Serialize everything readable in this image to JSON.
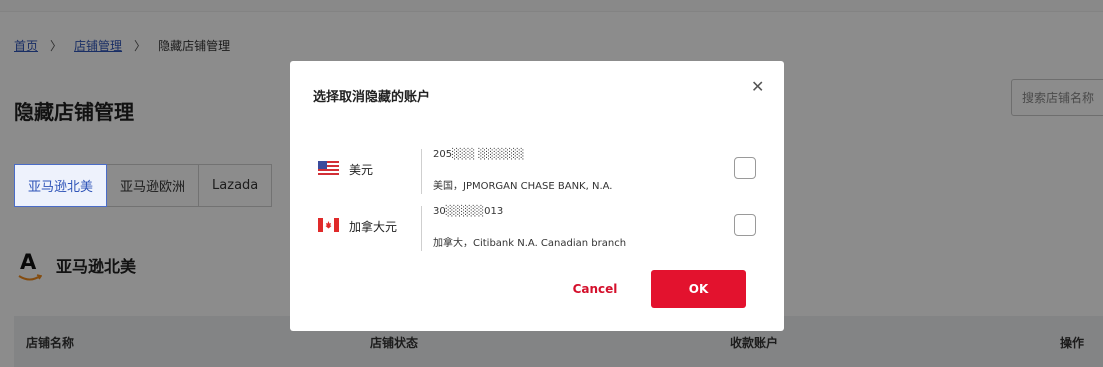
{
  "breadcrumb": {
    "home": "首页",
    "stores": "店铺管理",
    "current": "隐藏店铺管理",
    "separator": "〉"
  },
  "page": {
    "title": "隐藏店铺管理",
    "search_placeholder": "搜索店铺名称"
  },
  "tabs": [
    "亚马逊北美",
    "亚马逊欧洲",
    "Lazada"
  ],
  "section": {
    "title": "亚马逊北美",
    "logo_letter": "A"
  },
  "table": {
    "headers": [
      "店铺名称",
      "店铺状态",
      "收款账户",
      "操作"
    ]
  },
  "modal": {
    "title": "选择取消隐藏的账户",
    "close_glyph": "✕",
    "accounts": [
      {
        "currency": "美元",
        "flag": "us-flag-icon",
        "number": "205░░░ ░░░░░░",
        "bank": "美国，JPMORGAN CHASE BANK, N.A."
      },
      {
        "currency": "加拿大元",
        "flag": "canada-flag-icon",
        "number": "30░░░░░013",
        "bank": "加拿大，Citibank N.A. Canadian branch"
      }
    ],
    "cancel_label": "Cancel",
    "ok_label": "OK"
  },
  "colors": {
    "accent": "#e3122e",
    "link": "#2f54b8",
    "overlay": "rgba(0,0,0,0.45)"
  }
}
